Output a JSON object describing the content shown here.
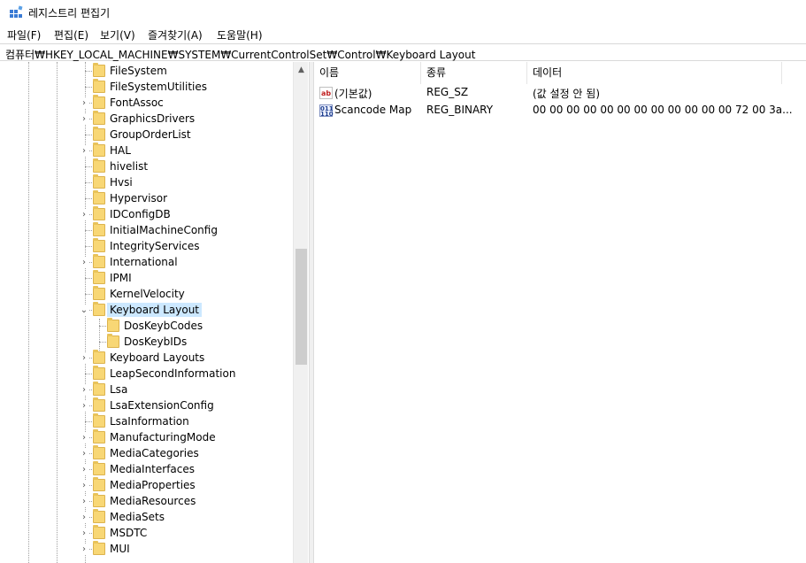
{
  "window": {
    "title": "레지스트리 편집기"
  },
  "menu": [
    "파일(F)",
    "편집(E)",
    "보기(V)",
    "즐겨찾기(A)",
    "도움말(H)"
  ],
  "address": "컴퓨터₩HKEY_LOCAL_MACHINE₩SYSTEM₩CurrentControlSet₩Control₩Keyboard Layout",
  "tree": [
    {
      "label": "FileSystem",
      "expandable": false,
      "level": 0
    },
    {
      "label": "FileSystemUtilities",
      "expandable": false,
      "level": 0
    },
    {
      "label": "FontAssoc",
      "expandable": true,
      "level": 0
    },
    {
      "label": "GraphicsDrivers",
      "expandable": true,
      "level": 0
    },
    {
      "label": "GroupOrderList",
      "expandable": false,
      "level": 0
    },
    {
      "label": "HAL",
      "expandable": true,
      "level": 0
    },
    {
      "label": "hivelist",
      "expandable": false,
      "level": 0
    },
    {
      "label": "Hvsi",
      "expandable": false,
      "level": 0
    },
    {
      "label": "Hypervisor",
      "expandable": false,
      "level": 0
    },
    {
      "label": "IDConfigDB",
      "expandable": true,
      "level": 0
    },
    {
      "label": "InitialMachineConfig",
      "expandable": false,
      "level": 0
    },
    {
      "label": "IntegrityServices",
      "expandable": false,
      "level": 0
    },
    {
      "label": "International",
      "expandable": true,
      "level": 0
    },
    {
      "label": "IPMI",
      "expandable": false,
      "level": 0
    },
    {
      "label": "KernelVelocity",
      "expandable": false,
      "level": 0
    },
    {
      "label": "Keyboard Layout",
      "expandable": true,
      "expanded": true,
      "selected": true,
      "level": 0
    },
    {
      "label": "DosKeybCodes",
      "expandable": false,
      "level": 1
    },
    {
      "label": "DosKeybIDs",
      "expandable": false,
      "level": 1
    },
    {
      "label": "Keyboard Layouts",
      "expandable": true,
      "level": 0
    },
    {
      "label": "LeapSecondInformation",
      "expandable": false,
      "level": 0
    },
    {
      "label": "Lsa",
      "expandable": true,
      "level": 0
    },
    {
      "label": "LsaExtensionConfig",
      "expandable": true,
      "level": 0
    },
    {
      "label": "LsaInformation",
      "expandable": false,
      "level": 0
    },
    {
      "label": "ManufacturingMode",
      "expandable": true,
      "level": 0
    },
    {
      "label": "MediaCategories",
      "expandable": true,
      "level": 0
    },
    {
      "label": "MediaInterfaces",
      "expandable": true,
      "level": 0
    },
    {
      "label": "MediaProperties",
      "expandable": true,
      "level": 0
    },
    {
      "label": "MediaResources",
      "expandable": true,
      "level": 0
    },
    {
      "label": "MediaSets",
      "expandable": true,
      "level": 0
    },
    {
      "label": "MSDTC",
      "expandable": true,
      "level": 0
    },
    {
      "label": "MUI",
      "expandable": true,
      "level": 0
    }
  ],
  "columns": {
    "name": "이름",
    "type": "종류",
    "data": "데이터"
  },
  "values": [
    {
      "icon": "string-value-icon",
      "name": "(기본값)",
      "type": "REG_SZ",
      "data": "(값 설정 안 됨)"
    },
    {
      "icon": "binary-value-icon",
      "name": "Scancode Map",
      "type": "REG_BINARY",
      "data": "00 00 00 00 00 00 00 00 00 00 00 00 72 00 3a..."
    }
  ],
  "icons": {
    "app": "registry-editor-icon",
    "string_glyph": "ab",
    "binary_glyph": "011\n110",
    "expand_glyph": "›",
    "expanded_glyph": "⌄",
    "scroll_up_glyph": "▲"
  },
  "colors": {
    "selection": "#cce8ff",
    "folder": "#f8d775"
  }
}
